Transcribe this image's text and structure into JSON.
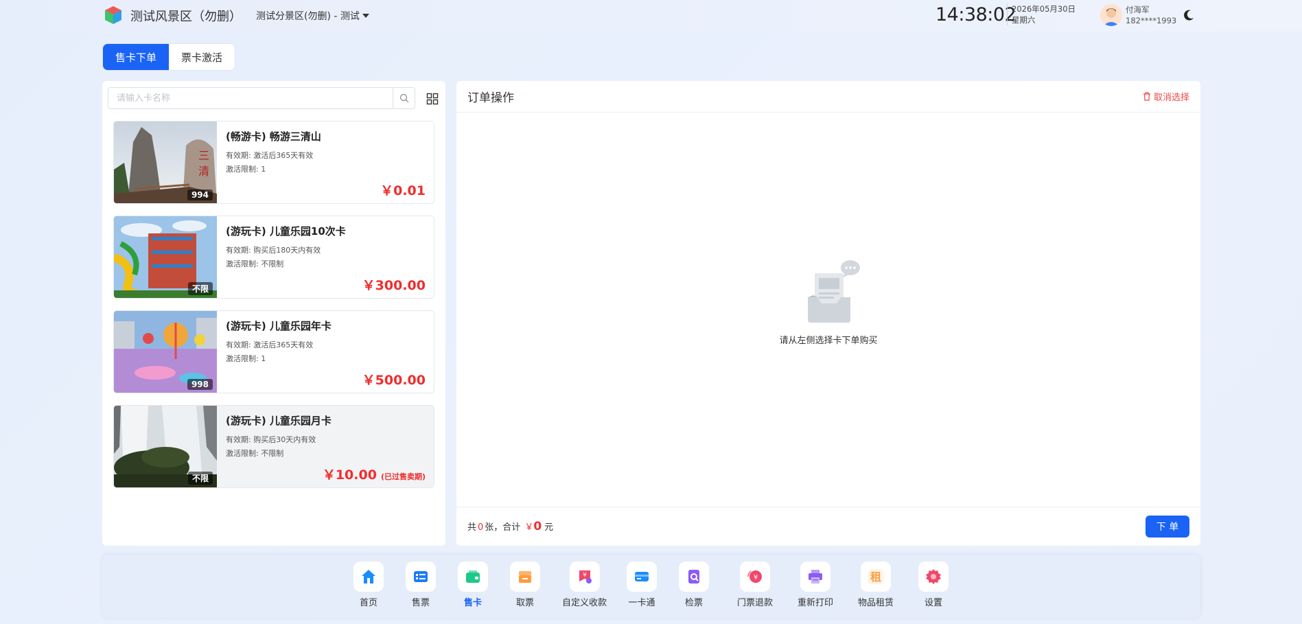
{
  "header": {
    "scenic_name": "测试风景区（勿删）",
    "subarea": "测试分景区(勿删) - 测试",
    "time": "14:38:02",
    "date": "2026年05月30日",
    "weekday": "星期六",
    "user_name": "付海军",
    "user_phone": "182****1993"
  },
  "tabs": [
    {
      "label": "售卡下单",
      "active": true
    },
    {
      "label": "票卡激活",
      "active": false
    }
  ],
  "search": {
    "placeholder": "请输入卡名称"
  },
  "cards": [
    {
      "title": "(畅游卡) 畅游三清山",
      "validity": "有效期: 激活后365天有效",
      "limit": "激活限制: 1",
      "price": "￥0.01",
      "stock": "994",
      "expired": false,
      "expired_label": ""
    },
    {
      "title": "(游玩卡) 儿童乐园10次卡",
      "validity": "有效期: 购买后180天内有效",
      "limit": "激活限制: 不限制",
      "price": "￥300.00",
      "stock": "不限",
      "expired": false,
      "expired_label": ""
    },
    {
      "title": "(游玩卡) 儿童乐园年卡",
      "validity": "有效期: 激活后365天有效",
      "limit": "激活限制: 1",
      "price": "￥500.00",
      "stock": "998",
      "expired": false,
      "expired_label": ""
    },
    {
      "title": "(游玩卡) 儿童乐园月卡",
      "validity": "有效期: 购买后30天内有效",
      "limit": "激活限制: 不限制",
      "price": "￥10.00",
      "stock": "不限",
      "expired": true,
      "expired_label": "(已过售卖期)"
    }
  ],
  "order_panel": {
    "title": "订单操作",
    "cancel_label": "取消选择",
    "empty_text": "请从左侧选择卡下单购买",
    "summary_prefix": "共",
    "count": "0",
    "summary_mid": "张，合计",
    "currency": "￥",
    "total": "0",
    "summary_suffix": "元",
    "order_button": "下 单"
  },
  "nav": [
    {
      "label": "首页",
      "icon": "home-icon",
      "color": "#1a8cff"
    },
    {
      "label": "售票",
      "icon": "ticket-list-icon",
      "color": "#1a7cf5"
    },
    {
      "label": "售卡",
      "icon": "wallet-card-icon",
      "color": "#1ec98a",
      "active": true
    },
    {
      "label": "取票",
      "icon": "ticket-pickup-icon",
      "color": "#ff9b3d"
    },
    {
      "label": "自定义收款",
      "icon": "custom-payment-icon",
      "color": "#f0486a"
    },
    {
      "label": "一卡通",
      "icon": "id-card-icon",
      "color": "#1a8cff"
    },
    {
      "label": "检票",
      "icon": "ticket-check-icon",
      "color": "#8a5cf6"
    },
    {
      "label": "门票退款",
      "icon": "refund-icon",
      "color": "#f0486a"
    },
    {
      "label": "重新打印",
      "icon": "printer-icon",
      "color": "#8a5cf6"
    },
    {
      "label": "物品租赁",
      "icon": "rent-icon",
      "color": "#ff9b3d"
    },
    {
      "label": "设置",
      "icon": "settings-icon",
      "color": "#f0486a"
    }
  ],
  "colors": {
    "primary": "#1a63f5",
    "price_red": "#f02d2d"
  }
}
